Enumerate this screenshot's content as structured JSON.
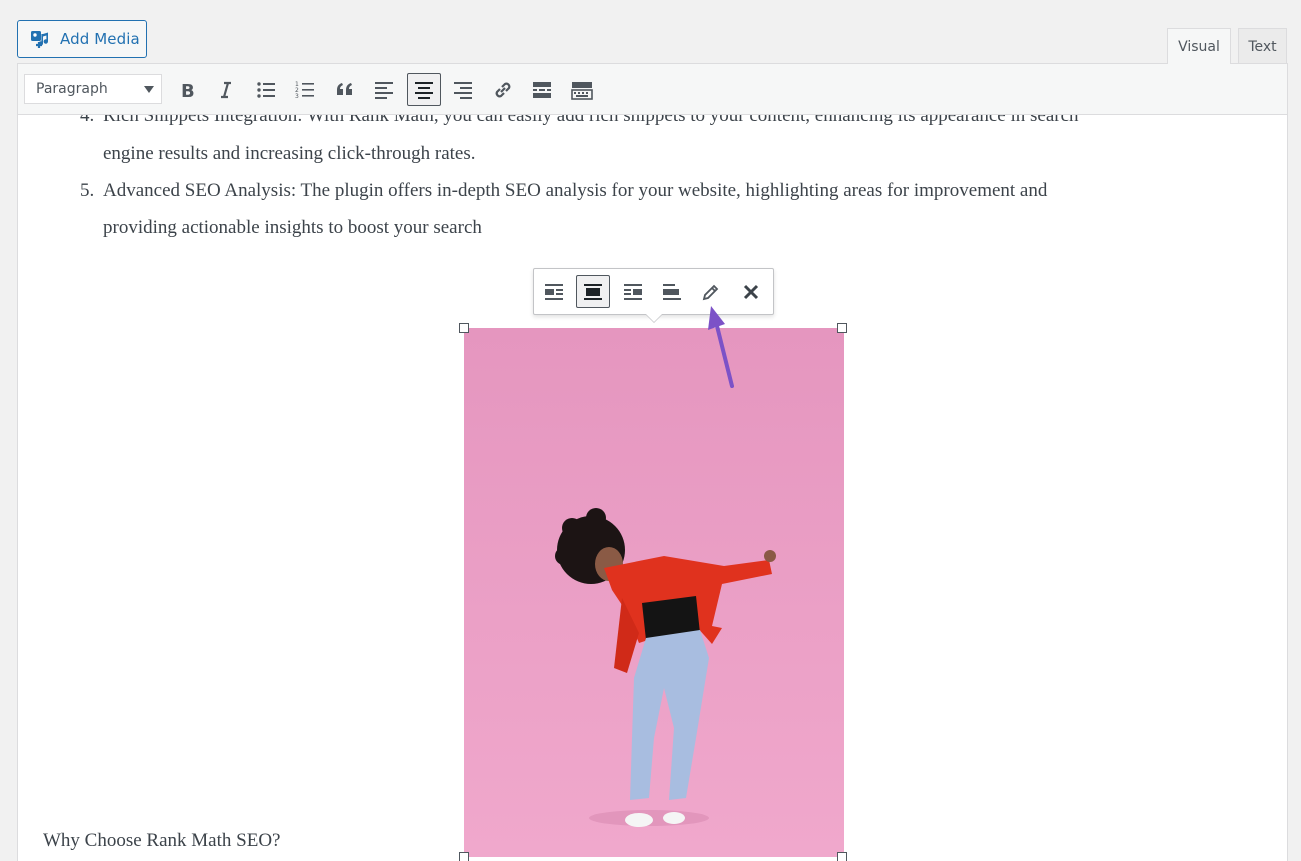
{
  "media_button": {
    "label": "Add Media",
    "icon": "add-media-icon"
  },
  "tabs": {
    "visual": "Visual",
    "text": "Text"
  },
  "toolbar": {
    "format_select": "Paragraph",
    "buttons": [
      "bold",
      "italic",
      "bulleted-list",
      "numbered-list",
      "blockquote",
      "align-left",
      "align-center",
      "align-right",
      "insert-link",
      "read-more",
      "toolbar-toggle"
    ],
    "active": "align-center"
  },
  "content": {
    "item4": {
      "number": "4.",
      "line1": "Rich Snippets Integration: With Rank Math, you can easily add rich snippets to your content, enhancing its appearance in search",
      "line2": "engine results and increasing click-through rates."
    },
    "item5": {
      "number": "5.",
      "line1": "Advanced SEO Analysis: The plugin offers in-depth SEO analysis for your website, highlighting areas for improvement and",
      "line2": "providing actionable insights to boost your search"
    },
    "heading_line": "Why Choose Rank Math SEO?"
  },
  "image_toolbar": {
    "buttons": [
      "align-left",
      "align-center",
      "align-right",
      "no-alignment",
      "edit",
      "remove"
    ],
    "active": "align-center"
  },
  "colors": {
    "accent": "#2271b1",
    "image_bg": "#ec9fc6",
    "annotation_arrow": "#7c52c7"
  }
}
